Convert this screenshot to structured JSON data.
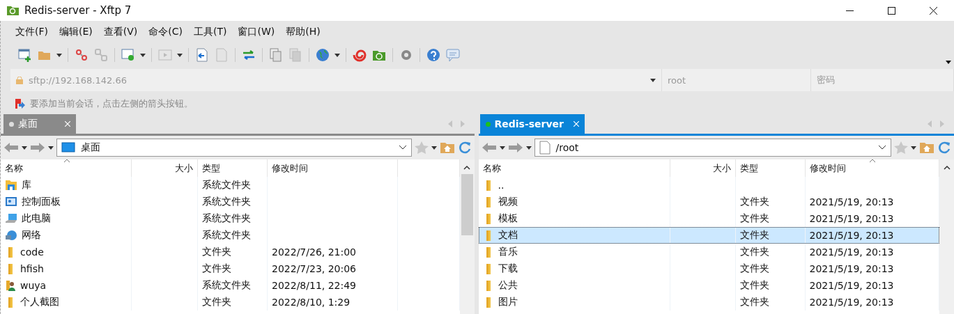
{
  "window": {
    "title": "Redis-server - Xftp 7"
  },
  "menu": [
    "文件(F)",
    "编辑(E)",
    "查看(V)",
    "命令(C)",
    "工具(T)",
    "窗口(W)",
    "帮助(H)"
  ],
  "address_bar": {
    "host": "sftp://192.168.142.66",
    "user": "root",
    "password_placeholder": "密码"
  },
  "hint": "要添加当前会话，点击左侧的箭头按钮。",
  "panes": [
    {
      "tab": {
        "label": "桌面",
        "selected": false
      },
      "path": "桌面",
      "columns": [
        "名称",
        "大小",
        "类型",
        "修改时间"
      ],
      "rows": [
        {
          "kind": "library",
          "name": "库",
          "type": "系统文件夹",
          "selected": false
        },
        {
          "kind": "control-panel",
          "name": "控制面板",
          "type": "系统文件夹",
          "selected": false
        },
        {
          "kind": "computer",
          "name": "此电脑",
          "type": "系统文件夹",
          "selected": false
        },
        {
          "kind": "network",
          "name": "网络",
          "type": "系统文件夹",
          "selected": false
        },
        {
          "kind": "folder",
          "name": "code",
          "type": "文件夹",
          "modified": "2022/7/26, 21:00",
          "selected": false
        },
        {
          "kind": "folder",
          "name": "hfish",
          "type": "文件夹",
          "modified": "2022/7/23, 20:06",
          "selected": false
        },
        {
          "kind": "user-folder",
          "name": "wuya",
          "type": "系统文件夹",
          "modified": "2022/8/11, 22:49",
          "selected": false
        },
        {
          "kind": "folder",
          "name": "个人截图",
          "type": "文件夹",
          "modified": "2022/8/10, 1:29",
          "selected": false
        }
      ]
    },
    {
      "tab": {
        "label": "Redis-server",
        "selected": true
      },
      "path": "/root",
      "columns": [
        "名称",
        "大小",
        "类型",
        "修改时间"
      ],
      "rows": [
        {
          "kind": "folder",
          "name": "..",
          "selected": false
        },
        {
          "kind": "folder",
          "name": "视频",
          "type": "文件夹",
          "modified": "2021/5/19, 20:13",
          "selected": false
        },
        {
          "kind": "folder",
          "name": "模板",
          "type": "文件夹",
          "modified": "2021/5/19, 20:13",
          "selected": false
        },
        {
          "kind": "folder",
          "name": "文档",
          "type": "文件夹",
          "modified": "2021/5/19, 20:13",
          "selected": true
        },
        {
          "kind": "folder",
          "name": "音乐",
          "type": "文件夹",
          "modified": "2021/5/19, 20:13",
          "selected": false
        },
        {
          "kind": "folder",
          "name": "下载",
          "type": "文件夹",
          "modified": "2021/5/19, 20:13",
          "selected": false
        },
        {
          "kind": "folder",
          "name": "公共",
          "type": "文件夹",
          "modified": "2021/5/19, 20:13",
          "selected": false
        },
        {
          "kind": "folder",
          "name": "图片",
          "type": "文件夹",
          "modified": "2021/5/19, 20:13",
          "selected": false
        }
      ]
    }
  ]
}
